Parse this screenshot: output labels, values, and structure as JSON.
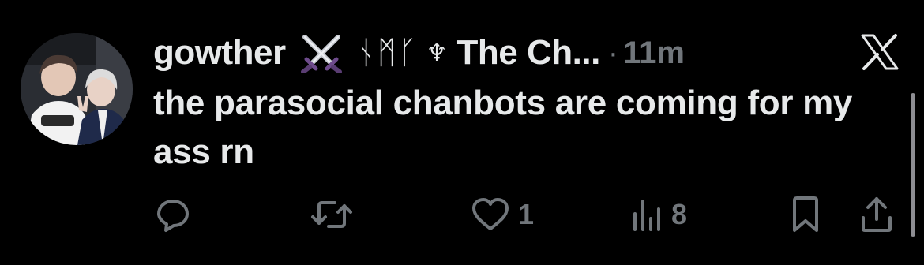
{
  "tweet": {
    "username": "gowther",
    "runes": "ᚾᛗᚴ",
    "trident": "♆",
    "display_name": "The Ch...",
    "separator": "·",
    "time": "11m",
    "text": "the parasocial chanbots are coming for my ass rn"
  },
  "metrics": {
    "likes": "1",
    "views": "8"
  },
  "icons": {
    "reply": "reply-icon",
    "retweet": "retweet-icon",
    "like": "heart-icon",
    "views": "views-icon",
    "bookmark": "bookmark-icon",
    "share": "share-icon",
    "brand": "x-logo-icon",
    "swords": "crossed-swords-icon"
  },
  "colors": {
    "background": "#000000",
    "text": "#e7e9ea",
    "muted": "#71767b"
  }
}
